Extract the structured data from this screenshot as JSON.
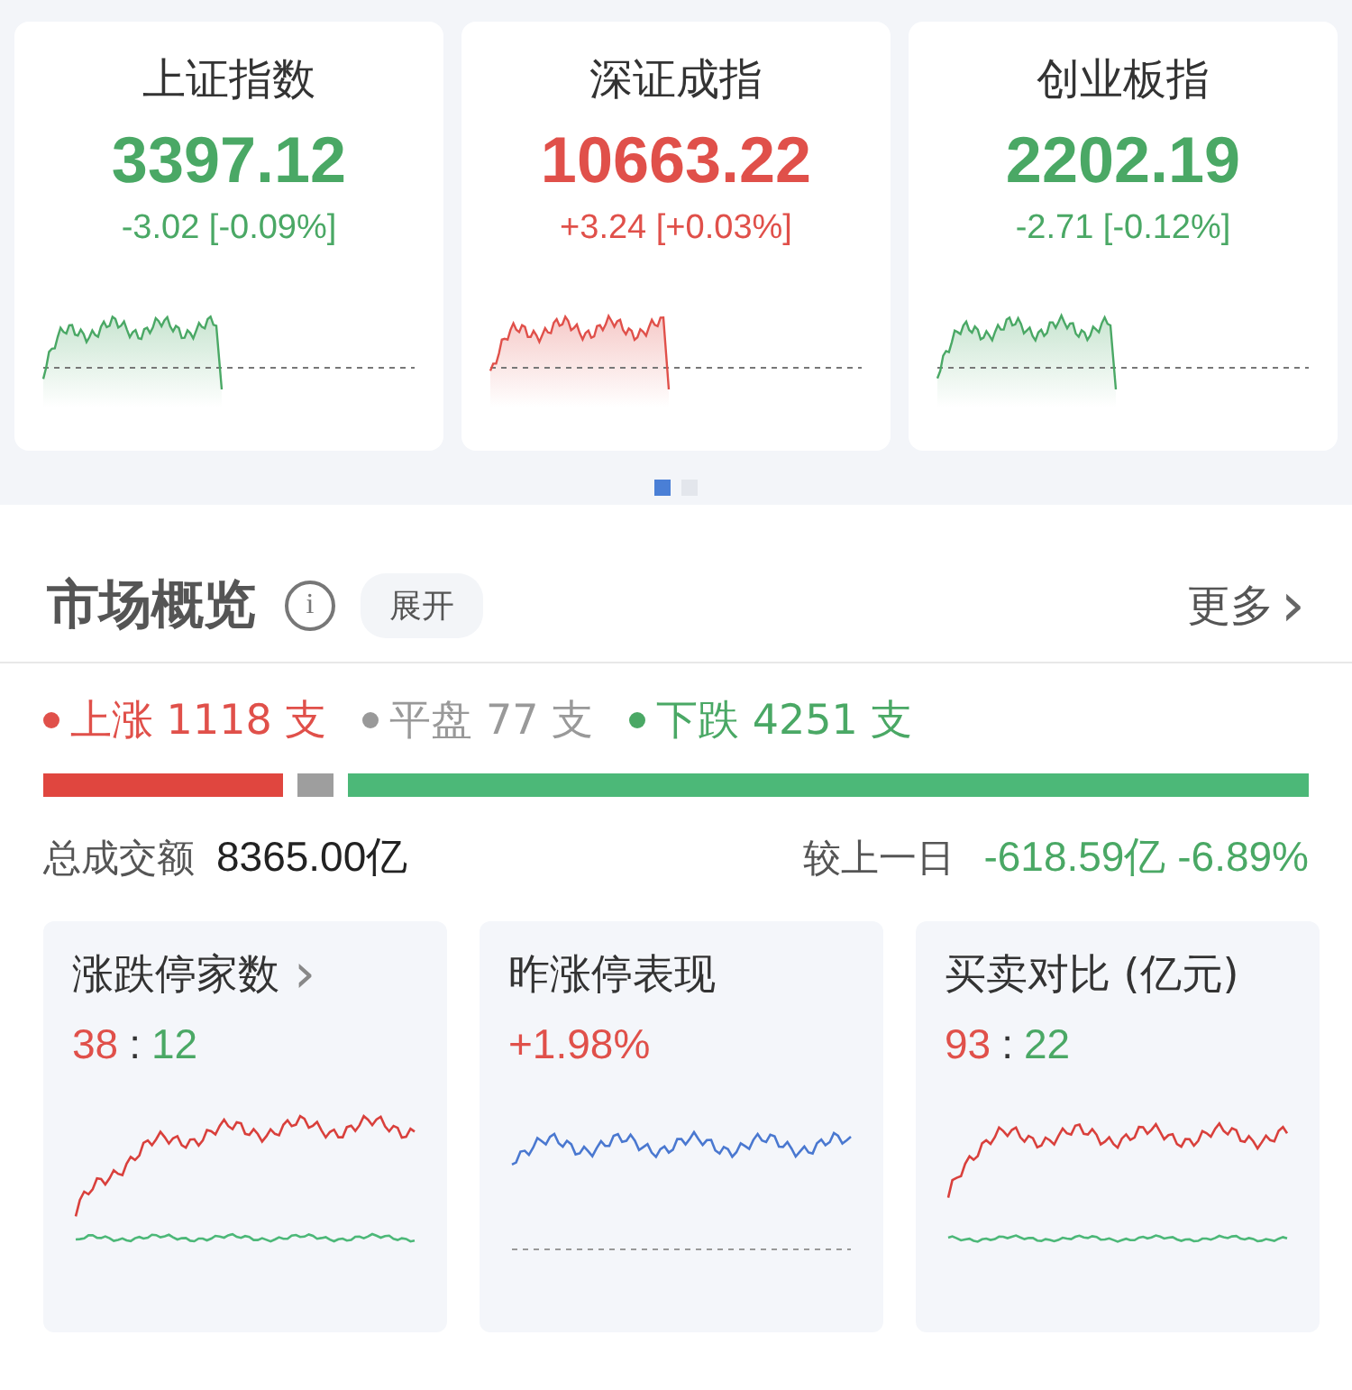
{
  "indices": [
    {
      "name": "上证指数",
      "value": "3397.12",
      "change": "-3.02 [-0.09%]",
      "color": "#4aa865"
    },
    {
      "name": "深证成指",
      "value": "10663.22",
      "change": "+3.24 [+0.03%]",
      "color": "#e0504a"
    },
    {
      "name": "创业板指",
      "value": "2202.19",
      "change": "-2.71 [-0.12%]",
      "color": "#4aa865"
    }
  ],
  "pager": [
    {
      "selected": true
    },
    {
      "selected": false
    }
  ],
  "overview": {
    "title": "市场概览",
    "info_icon": "i",
    "expand": "展开",
    "more": "更多",
    "more_icon": "›"
  },
  "breadth": {
    "legend": [
      {
        "label": "上涨 1118 支",
        "color": "#e0504a"
      },
      {
        "label": "平盘 77 支",
        "color": "#999999"
      },
      {
        "label": "下跌 4251 支",
        "color": "#4aa865"
      }
    ]
  },
  "turnover": {
    "label": "总成交额",
    "value": "8365.00亿",
    "compare_label": "较上一日",
    "change": "-618.59亿 -6.89%"
  },
  "cards": [
    {
      "title": "涨跌停家数",
      "arrow": "›",
      "parts": [
        {
          "text": "38",
          "color": "#e0504a"
        },
        {
          "text": ":",
          "color": "#333333"
        },
        {
          "text": "12",
          "color": "#4aa865"
        }
      ]
    },
    {
      "title": "昨涨停表现",
      "parts": [
        {
          "text": "+1.98%",
          "color": "#e0504a"
        }
      ]
    },
    {
      "title": "买卖对比 (亿元)",
      "parts": [
        {
          "text": "93",
          "color": "#e0504a"
        },
        {
          "text": ":",
          "color": "#333333"
        },
        {
          "text": "22",
          "color": "#4aa865"
        }
      ]
    }
  ]
}
